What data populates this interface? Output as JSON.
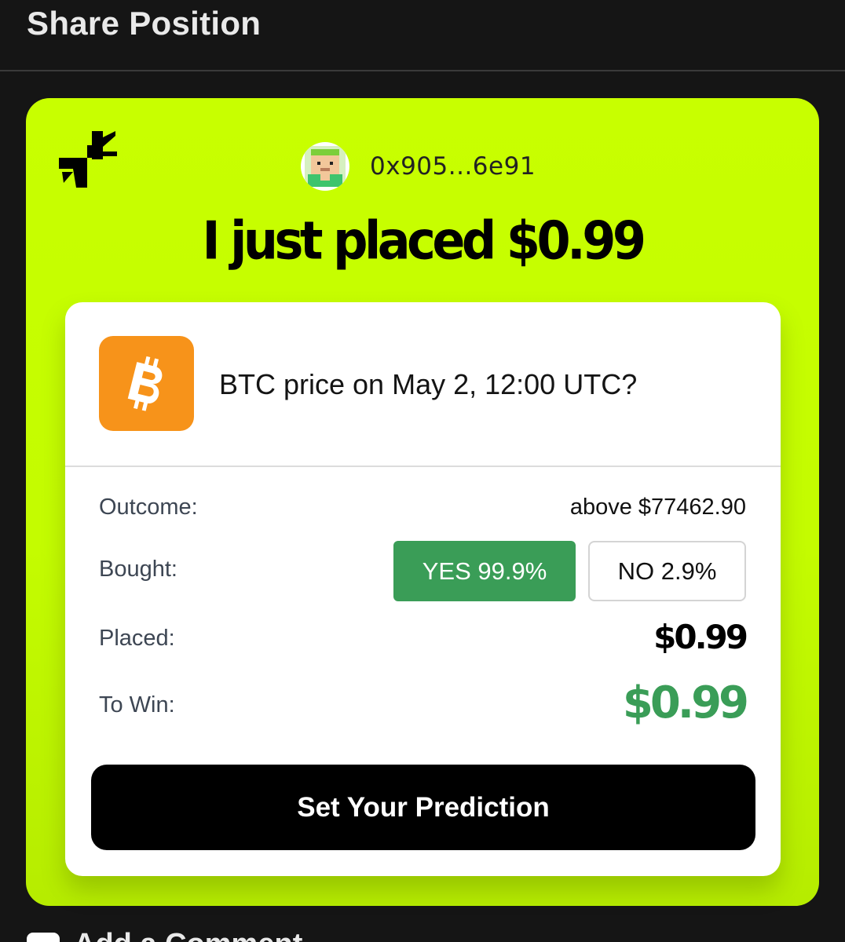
{
  "header": {
    "title": "Share Position"
  },
  "card": {
    "background_color": "#c8ff00",
    "logo_icon": "brand-logo-icon",
    "user": {
      "avatar_icon": "pixel-avatar-icon",
      "address": "0x905...6e91"
    },
    "headline": "I just placed $0.99"
  },
  "market": {
    "icon": "bitcoin-icon",
    "icon_color": "#f7931a",
    "question": "BTC price on May 2, 12:00 UTC?"
  },
  "details": {
    "outcome_label": "Outcome:",
    "outcome_value": "above $77462.90",
    "bought_label": "Bought:",
    "yes_option": "YES 99.9%",
    "no_option": "NO 2.9%",
    "selected_option": "yes",
    "placed_label": "Placed:",
    "placed_value": "$0.99",
    "to_win_label": "To Win:",
    "to_win_value": "$0.99",
    "yes_color": "#3a9d57"
  },
  "cta": {
    "label": "Set Your Prediction"
  },
  "footer": {
    "comment_icon": "comment-icon",
    "label": "Add a Comment"
  }
}
